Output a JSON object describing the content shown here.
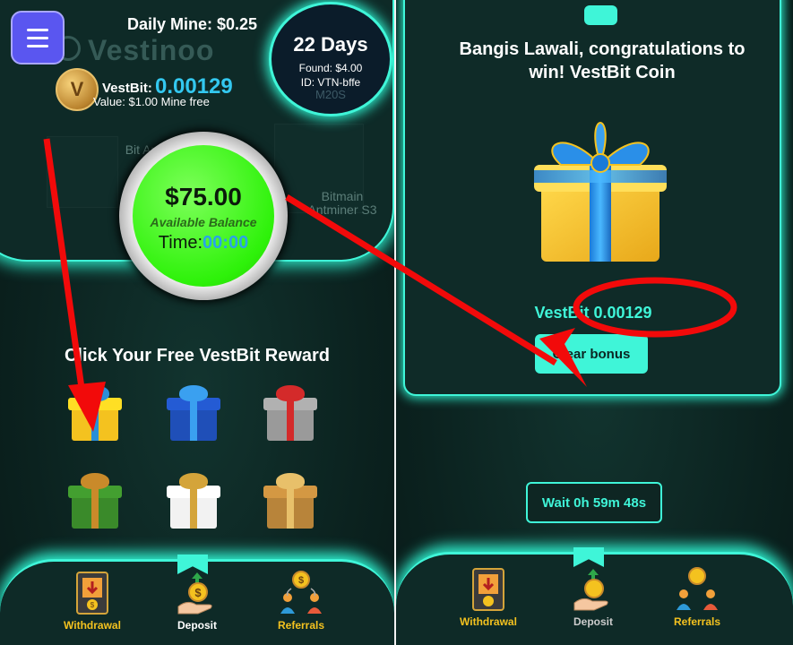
{
  "left": {
    "menu_icon": "hamburger-menu-icon",
    "brand": "Vestinoo",
    "daily_mine": "Daily Mine: $0.25",
    "coin_icon": "vestbit-coin-icon",
    "coin_letter": "V",
    "vestbit_label": "VestBit:",
    "vestbit_value": "0.00129",
    "value_line": "Value: $1.00 Mine free",
    "days": {
      "title": "22 Days",
      "found": "Found: $4.00",
      "id": "ID: VTN-bffe",
      "ghost": "M20S"
    },
    "ghost_miners": [
      "Bitmain Antminer S3",
      "Bit An"
    ],
    "balance": {
      "amount": "$75.00",
      "label": "Available Balance",
      "time_label": "Time:",
      "time_value": "00:00"
    },
    "reward_title": "Click Your Free VestBit Reward",
    "gifts": [
      {
        "name": "gift-yellow-blue",
        "box": "#f4c21f",
        "ribbon": "#2a8fd8"
      },
      {
        "name": "gift-blue",
        "box": "#1f4fb8",
        "ribbon": "#3aa0f0"
      },
      {
        "name": "gift-white-red",
        "box": "#9a9a9a",
        "ribbon": "#d42a2a"
      },
      {
        "name": "gift-green",
        "box": "#3a8a2a",
        "ribbon": "#c98a2a"
      },
      {
        "name": "gift-white-gold",
        "box": "#f2f2f2",
        "ribbon": "#d4a43a"
      },
      {
        "name": "gift-gold",
        "box": "#b8843a",
        "ribbon": "#e8c06a"
      }
    ]
  },
  "right": {
    "win_title": "Bangis Lawali, congratulations to win! VestBit Coin",
    "gift_icon": "prize-gift-icon",
    "vestbit_prefix": "VestBit",
    "vestbit_value": "0.00129",
    "clear_button": "Clear bonus",
    "wait_button": "Wait 0h 59m 48s"
  },
  "nav": [
    {
      "label": "Withdrawal",
      "icon": "withdrawal-icon"
    },
    {
      "label": "Deposit",
      "icon": "deposit-icon"
    },
    {
      "label": "Referrals",
      "icon": "referrals-icon"
    }
  ],
  "colors": {
    "accent": "#3ff5d8",
    "balance_green": "#2ef20a",
    "annotation_red": "#f20a0a",
    "menu_purple": "#5a56f0",
    "vestbit_blue": "#33c8f0"
  }
}
